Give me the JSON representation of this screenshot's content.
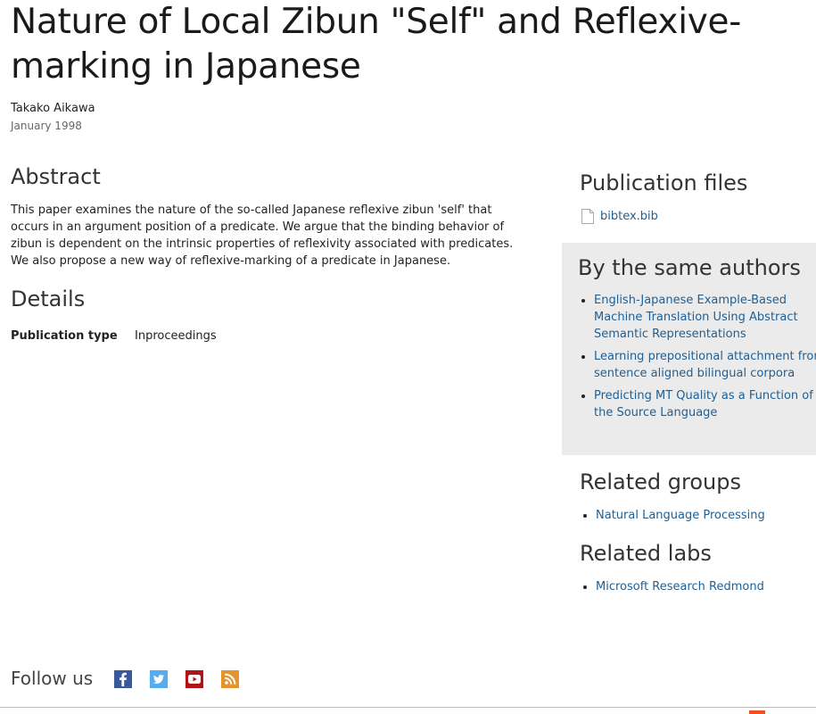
{
  "title": "Nature of Local Zibun \"Self\" and Reflexive-marking in Japanese",
  "author": "Takako Aikawa",
  "date": "January 1998",
  "abstract": {
    "heading": "Abstract",
    "text": "This paper examines the nature of the so-called Japanese reflexive zibun 'self' that occurs in an argument position of a predicate. We argue that the binding behavior of zibun is dependent on the intrinsic properties of reflexivity associated with predicates. We also propose a new way of reflexive-marking of a predicate in Japanese."
  },
  "details": {
    "heading": "Details",
    "rows": [
      {
        "label": "Publication type",
        "value": "Inproceedings"
      }
    ]
  },
  "publication_files": {
    "heading": "Publication files",
    "file_icon": "document-icon",
    "files": [
      {
        "label": "bibtex.bib"
      }
    ]
  },
  "same_authors": {
    "heading": "By the same authors",
    "items": [
      {
        "label": "English-Japanese Example-Based Machine Translation Using Abstract Semantic Representations"
      },
      {
        "label": "Learning prepositional attachment from sentence aligned bilingual corpora"
      },
      {
        "label": "Predicting MT Quality as a Function of the Source Language"
      }
    ]
  },
  "related_groups": {
    "heading": "Related groups",
    "items": [
      {
        "label": "Natural Language Processing"
      }
    ]
  },
  "related_labs": {
    "heading": "Related labs",
    "items": [
      {
        "label": "Microsoft Research Redmond"
      }
    ]
  },
  "follow": {
    "label": "Follow us",
    "icons": [
      "facebook-icon",
      "twitter-icon",
      "youtube-icon",
      "rss-icon"
    ]
  },
  "colors": {
    "link": "#1f5f94",
    "sidebar_panel": "#ebebeb",
    "facebook": "#3b5998",
    "twitter": "#55acee",
    "youtube": "#b31217",
    "rss": "#e5932a"
  }
}
